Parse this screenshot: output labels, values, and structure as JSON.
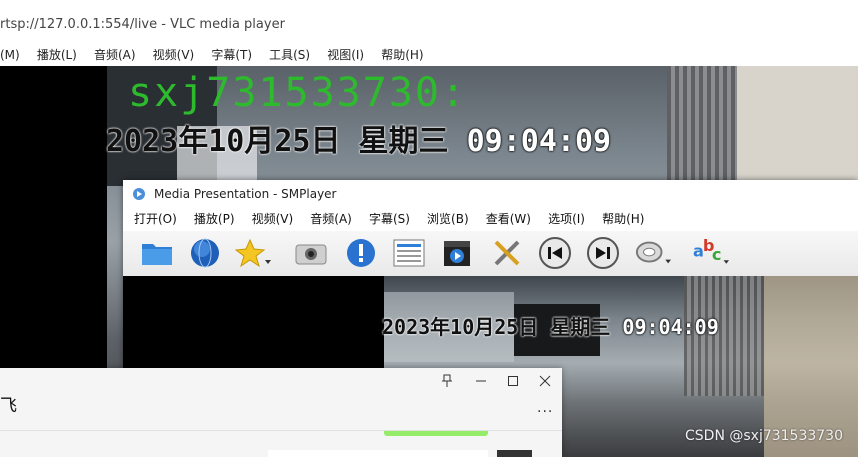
{
  "vlc": {
    "title": "rtsp://127.0.0.1:554/live - VLC media player",
    "menu": [
      "(M)",
      "播放(L)",
      "音频(A)",
      "视频(V)",
      "字幕(T)",
      "工具(S)",
      "视图(I)",
      "帮助(H)"
    ],
    "osd_name": "sxj731533730:",
    "osd_date": "2023年10月25日 星期三",
    "osd_time": "09:04:09"
  },
  "smplayer": {
    "title": "Media Presentation - SMPlayer",
    "menu": [
      "打开(O)",
      "播放(P)",
      "视频(V)",
      "音频(A)",
      "字幕(S)",
      "浏览(B)",
      "查看(W)",
      "选项(I)",
      "帮助(H)"
    ],
    "toolbar_icons": [
      "folder-icon",
      "globe-icon",
      "favorites-star-icon",
      "screenshot-camera-icon",
      "info-icon",
      "playlist-icon",
      "clapperboard-icon",
      "tools-icon",
      "previous-icon",
      "next-icon",
      "audio-track-icon",
      "subtitle-abc-icon"
    ],
    "osd_date": "2023年10月25日 星期三",
    "osd_time": "09:04:09"
  },
  "chat": {
    "title": "飞",
    "more": "..."
  },
  "watermark": "CSDN @sxj731533730",
  "colors": {
    "osd_green": "#2dbb2d",
    "bubble_green": "#95ec69",
    "toolbar_blue": "#2f7fd6"
  }
}
